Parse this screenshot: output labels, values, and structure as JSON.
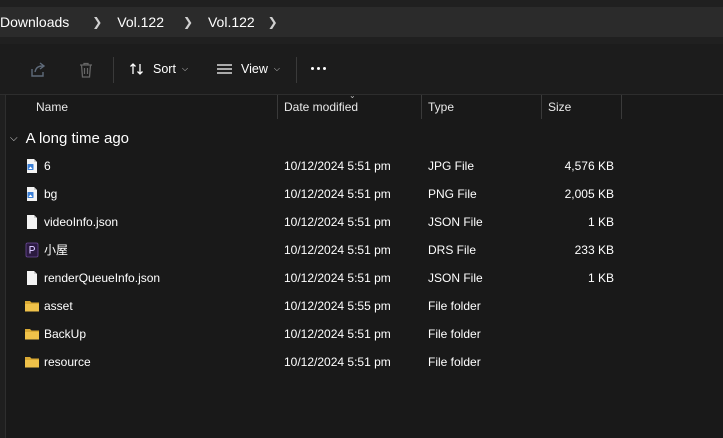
{
  "breadcrumb": [
    "Downloads",
    "Vol.122",
    "Vol.122"
  ],
  "toolbar": {
    "sort_label": "Sort",
    "view_label": "View"
  },
  "columns": {
    "name": "Name",
    "date": "Date modified",
    "type": "Type",
    "size": "Size"
  },
  "group": {
    "label": "A long time ago"
  },
  "files": [
    {
      "name": "6",
      "date": "10/12/2024 5:51 pm",
      "type": "JPG File",
      "size": "4,576 KB",
      "icon": "image-file-icon"
    },
    {
      "name": "bg",
      "date": "10/12/2024 5:51 pm",
      "type": "PNG File",
      "size": "2,005 KB",
      "icon": "image-file-icon"
    },
    {
      "name": "videoInfo.json",
      "date": "10/12/2024 5:51 pm",
      "type": "JSON File",
      "size": "1 KB",
      "icon": "document-file-icon"
    },
    {
      "name": "小屋",
      "date": "10/12/2024 5:51 pm",
      "type": "DRS File",
      "size": "233 KB",
      "icon": "drs-file-icon"
    },
    {
      "name": "renderQueueInfo.json",
      "date": "10/12/2024 5:51 pm",
      "type": "JSON File",
      "size": "1 KB",
      "icon": "document-file-icon"
    },
    {
      "name": "asset",
      "date": "10/12/2024 5:55 pm",
      "type": "File folder",
      "size": "",
      "icon": "folder-icon"
    },
    {
      "name": "BackUp",
      "date": "10/12/2024 5:51 pm",
      "type": "File folder",
      "size": "",
      "icon": "folder-icon"
    },
    {
      "name": "resource",
      "date": "10/12/2024 5:51 pm",
      "type": "File folder",
      "size": "",
      "icon": "folder-icon"
    }
  ],
  "colors": {
    "background": "#191919",
    "folder": "#f0c24a",
    "image_icon_accent": "#3b7fd6",
    "drs_icon": "#4b2a6e"
  }
}
